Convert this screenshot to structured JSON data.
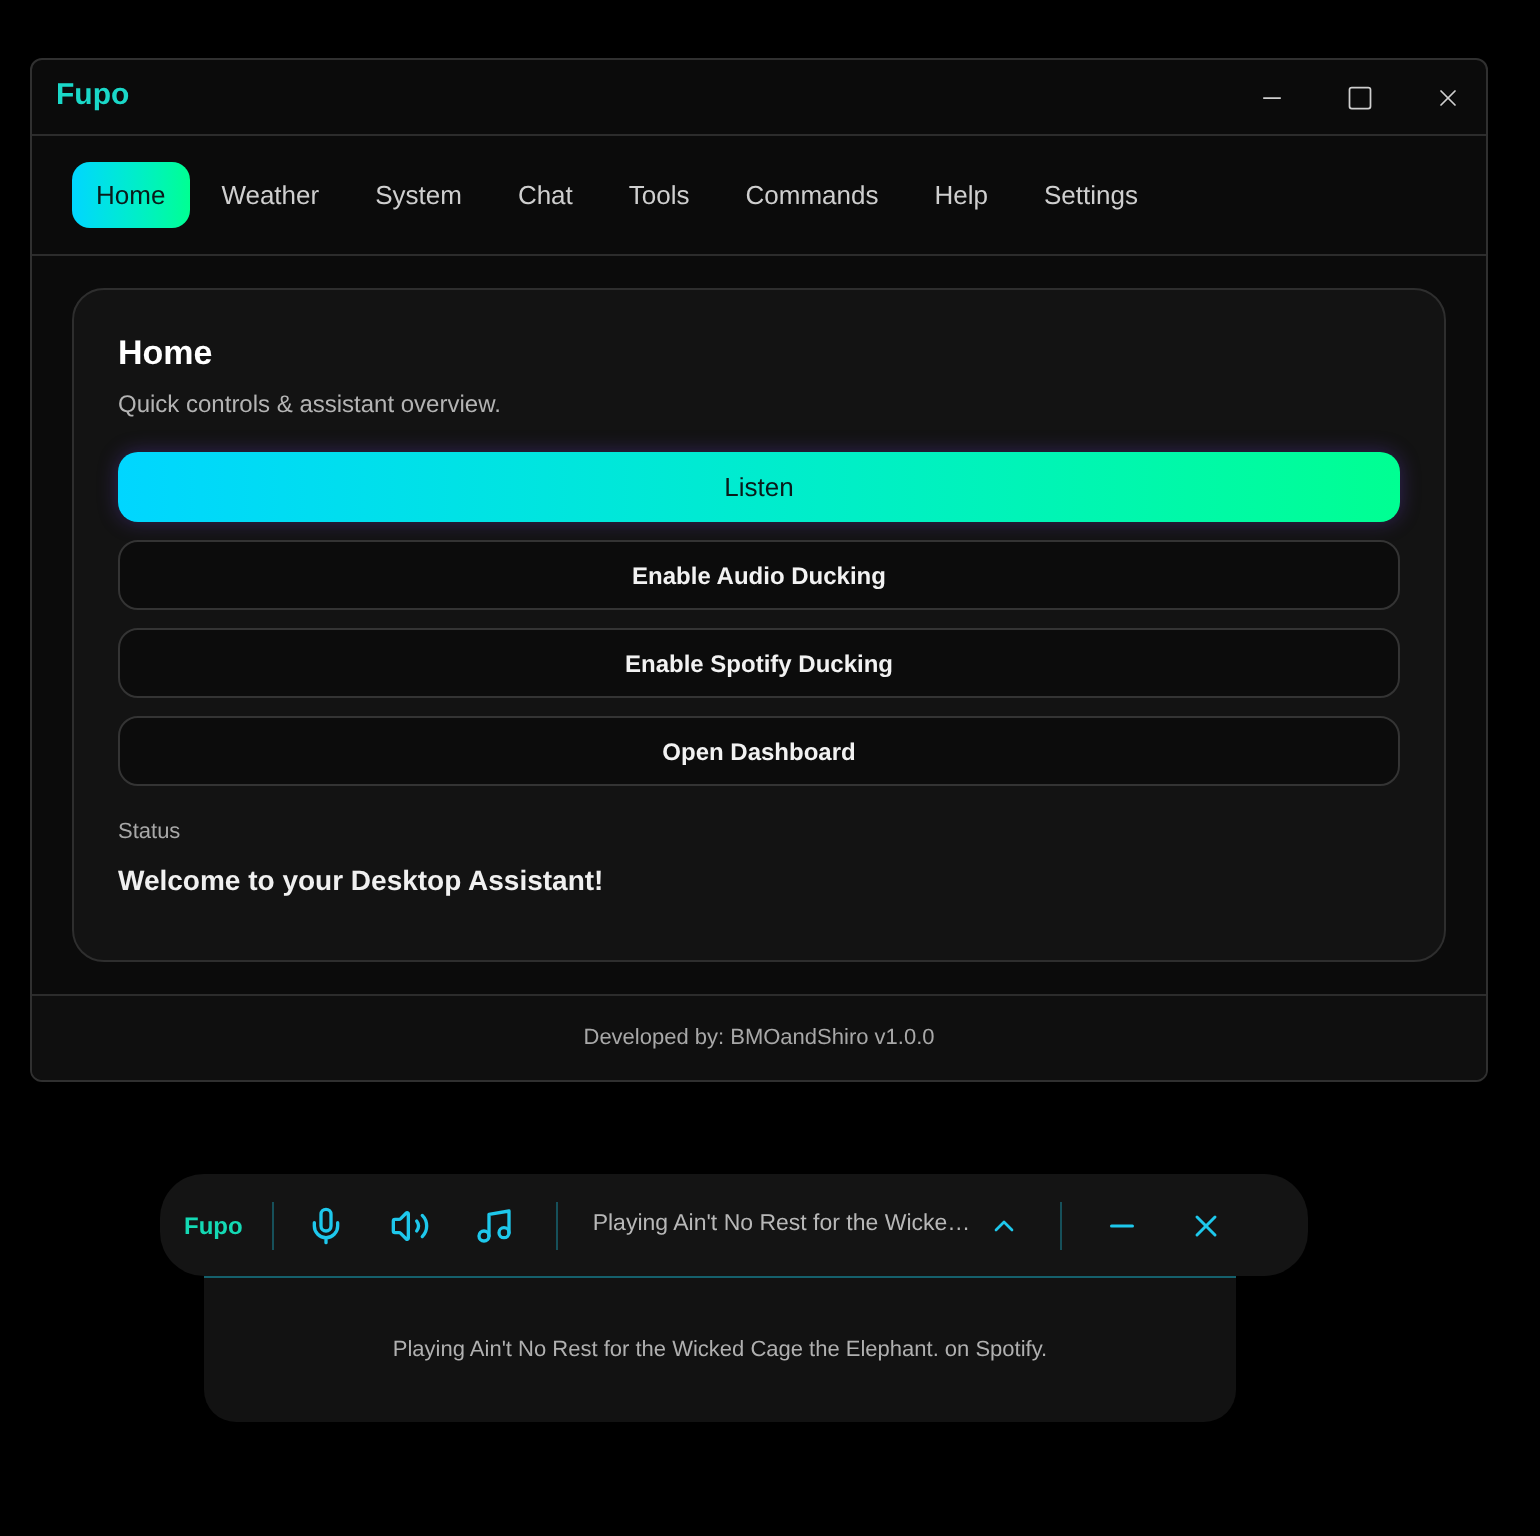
{
  "window": {
    "title": "Fupo"
  },
  "tabs": [
    {
      "label": "Home",
      "selected": true
    },
    {
      "label": "Weather",
      "selected": false
    },
    {
      "label": "System",
      "selected": false
    },
    {
      "label": "Chat",
      "selected": false
    },
    {
      "label": "Tools",
      "selected": false
    },
    {
      "label": "Commands",
      "selected": false
    },
    {
      "label": "Help",
      "selected": false
    },
    {
      "label": "Settings",
      "selected": false
    }
  ],
  "card": {
    "title": "Home",
    "subtitle": "Quick controls & assistant overview.",
    "buttons": [
      {
        "label": "Listen",
        "kind": "primary"
      },
      {
        "label": "Enable Audio Ducking",
        "kind": "outline"
      },
      {
        "label": "Enable Spotify Ducking",
        "kind": "outline"
      },
      {
        "label": "Open Dashboard",
        "kind": "outline"
      }
    ],
    "status_label": "Status",
    "status_text": "Welcome to your Desktop Assistant!"
  },
  "footer": "Developed by: BMOandShiro v1.0.0",
  "mini_player": {
    "title": "Fupo",
    "now_playing": "Playing Ain't No Rest for the Wicke…",
    "expanded": true,
    "panel_text": "Playing Ain't No Rest for the Wicked Cage the Elephant. on Spotify."
  }
}
